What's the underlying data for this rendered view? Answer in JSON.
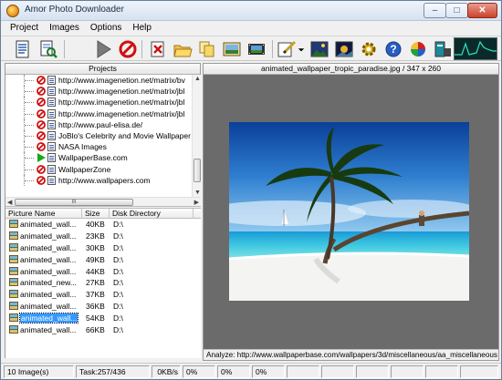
{
  "window": {
    "title": "Amor Photo Downloader"
  },
  "menu": [
    "Project",
    "Images",
    "Options",
    "Help"
  ],
  "toolbar": [
    "new-project-icon",
    "open-project-icon",
    "start-icon",
    "stop-icon",
    "delete-icon",
    "open-folder-icon",
    "copy-icon",
    "slideshow-icon",
    "film-icon",
    "edit-icon",
    "landscape-icon",
    "photo-view-icon",
    "settings-icon",
    "help-icon",
    "colors-icon",
    "monitor-icon",
    "network-graph-icon"
  ],
  "projects": {
    "header": "Projects",
    "items": [
      {
        "label": "http://www.imagenetion.net/matrix/bv",
        "status": "stopped"
      },
      {
        "label": "http://www.imagenetion.net/matrix/jbl",
        "status": "stopped"
      },
      {
        "label": "http://www.imagenetion.net/matrix/jbl",
        "status": "stopped"
      },
      {
        "label": "http://www.imagenetion.net/matrix/jbl",
        "status": "stopped"
      },
      {
        "label": "http://www.paul-elisa.de/",
        "status": "stopped"
      },
      {
        "label": "JoBlo's Celebrity and Movie Wallpaper",
        "status": "stopped"
      },
      {
        "label": "NASA Images",
        "status": "stopped"
      },
      {
        "label": "WallpaperBase.com",
        "status": "running"
      },
      {
        "label": "WallpaperZone",
        "status": "stopped"
      },
      {
        "label": "http://www.wallpapers.com",
        "status": "stopped"
      }
    ],
    "hscroll_grip": "III"
  },
  "picture_list": {
    "columns": [
      "Picture Name",
      "Size",
      "Disk Directory"
    ],
    "rows": [
      {
        "name": "animated_wall...",
        "size": "40KB",
        "dir": "D:\\"
      },
      {
        "name": "animated_wall...",
        "size": "23KB",
        "dir": "D:\\"
      },
      {
        "name": "animated_wall...",
        "size": "30KB",
        "dir": "D:\\"
      },
      {
        "name": "animated_wall...",
        "size": "49KB",
        "dir": "D:\\"
      },
      {
        "name": "animated_wall...",
        "size": "44KB",
        "dir": "D:\\"
      },
      {
        "name": "animated_new...",
        "size": "27KB",
        "dir": "D:\\"
      },
      {
        "name": "animated_wall...",
        "size": "37KB",
        "dir": "D:\\"
      },
      {
        "name": "animated_wall...",
        "size": "36KB",
        "dir": "D:\\"
      },
      {
        "name": "animated_wall...",
        "size": "54KB",
        "dir": "D:\\",
        "selected": true
      },
      {
        "name": "animated_wall...",
        "size": "66KB",
        "dir": "D:\\"
      }
    ]
  },
  "preview": {
    "header": "animated_wallpaper_tropic_paradise.jpg / 347 x 260",
    "analyze": "Analyze: http://www.wallpaperbase.com/wallpapers/3d/miscellaneous/aa_miscellaneous"
  },
  "status": {
    "images": "10 Image(s)",
    "task": "Task:257/436",
    "speed": "0KB/s",
    "p1": "0%",
    "p2": "0%",
    "p3": "0%"
  }
}
